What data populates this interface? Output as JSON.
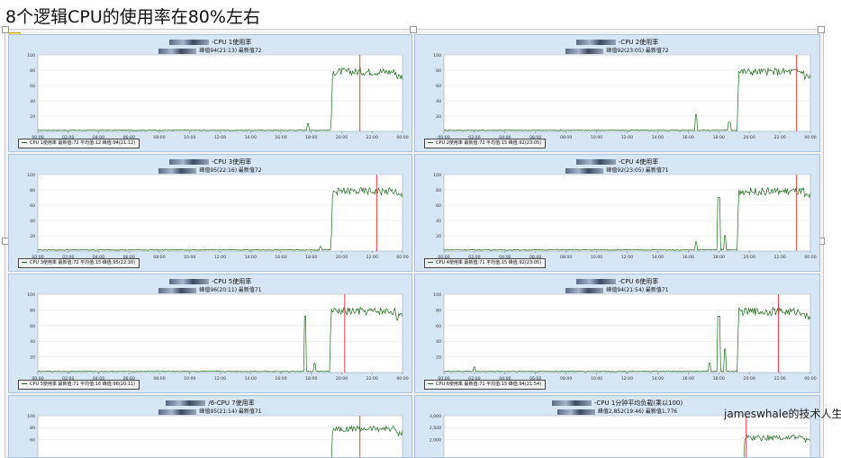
{
  "page_title": "8个逻辑CPU的使用率在80%左右",
  "watermark": "jameswhale的技术人生",
  "colors": {
    "series": "#1a6b1a",
    "marker": "#e0262c",
    "panel_bg": "#d6e6f5",
    "plot_bg": "#ffffff",
    "grid": "#e2e2e2"
  },
  "icons": {
    "favorite": "star-icon"
  },
  "chart_data": [
    {
      "type": "line",
      "title": "-CPU 1使用率",
      "subtitle": "峰值94(21:13) 最新值72",
      "yticks": [
        "100",
        "80",
        "60",
        "40",
        "20"
      ],
      "ylim": [
        0,
        100
      ],
      "xticks": [
        "00:00",
        "02:00",
        "04:00",
        "06:00",
        "08:00",
        "10:00",
        "12:00",
        "14:00",
        "16:00",
        "18:00",
        "20:00",
        "22:00",
        "00:00"
      ],
      "legend": "CPU 1使用率 最新值:72 平均值:12 峰值:94(21:12)",
      "series": [
        {
          "name": "CPU 1使用率",
          "baseline": 1,
          "spikes": [
            [
              17.8,
              10
            ]
          ],
          "rise_at": 19.3,
          "plateau": 78,
          "end_value": 72
        }
      ],
      "marker_hour": 21.2
    },
    {
      "type": "line",
      "title": "-CPU 2使用率",
      "subtitle": "峰值92(23:05) 最新值72",
      "yticks": [
        "100",
        "80",
        "60",
        "40",
        "20"
      ],
      "ylim": [
        0,
        100
      ],
      "xticks": [
        "00:00",
        "02:00",
        "04:00",
        "06:00",
        "08:00",
        "10:00",
        "12:00",
        "14:00",
        "16:00",
        "18:00",
        "20:00",
        "22:00",
        "00:00"
      ],
      "legend": "CPU 2使用率 最新值:72 平均值:15 峰值:92(23:05)",
      "series": [
        {
          "name": "CPU 2使用率",
          "baseline": 1,
          "spikes": [
            [
              16.5,
              22
            ],
            [
              18.7,
              12
            ]
          ],
          "rise_at": 19.2,
          "plateau": 78,
          "end_value": 72
        }
      ],
      "marker_hour": 23.1
    },
    {
      "type": "line",
      "title": "-CPU 3使用率",
      "subtitle": "峰值95(22:16) 最新值72",
      "yticks": [
        "100",
        "80",
        "60",
        "40",
        "20"
      ],
      "ylim": [
        0,
        100
      ],
      "xticks": [
        "00:00",
        "02:00",
        "04:00",
        "06:00",
        "08:00",
        "10:00",
        "12:00",
        "14:00",
        "16:00",
        "18:00",
        "20:00",
        "22:00",
        "00:00"
      ],
      "legend": "CPU 3使用率 最新值:72 平均值:15 峰值:95(22:16)",
      "series": [
        {
          "name": "CPU 3使用率",
          "baseline": 1,
          "spikes": [
            [
              18.6,
              6
            ]
          ],
          "rise_at": 19.3,
          "plateau": 78,
          "end_value": 72
        }
      ],
      "marker_hour": 22.3
    },
    {
      "type": "line",
      "title": "-CPU 4使用率",
      "subtitle": "峰值92(23:05) 最新值71",
      "yticks": [
        "100",
        "80",
        "60",
        "40",
        "20"
      ],
      "ylim": [
        0,
        100
      ],
      "xticks": [
        "00:00",
        "02:00",
        "04:00",
        "06:00",
        "08:00",
        "10:00",
        "12:00",
        "14:00",
        "16:00",
        "18:00",
        "20:00",
        "22:00",
        "00:00"
      ],
      "legend": "CPU 4使用率 最新值:71 平均值:15 峰值:92(23:05)",
      "series": [
        {
          "name": "CPU 4使用率",
          "baseline": 1,
          "spikes": [
            [
              16.5,
              12
            ],
            [
              18.0,
              70
            ],
            [
              18.4,
              20
            ]
          ],
          "rise_at": 19.2,
          "plateau": 78,
          "end_value": 71
        }
      ],
      "marker_hour": 23.1
    },
    {
      "type": "line",
      "title": "-CPU 5使用率",
      "subtitle": "峰值96(20:11) 最新值71",
      "yticks": [
        "100",
        "80",
        "60",
        "40",
        "20"
      ],
      "ylim": [
        0,
        100
      ],
      "xticks": [
        "00:00",
        "02:00",
        "04:00",
        "06:00",
        "08:00",
        "10:00",
        "12:00",
        "14:00",
        "16:00",
        "18:00",
        "20:00",
        "22:00",
        "00:00"
      ],
      "legend": "CPU 5使用率 最新值:71 平均值:16 峰值:96(20:11)",
      "series": [
        {
          "name": "CPU 5使用率",
          "baseline": 1,
          "spikes": [
            [
              17.6,
              72
            ],
            [
              18.2,
              12
            ]
          ],
          "rise_at": 19.2,
          "plateau": 78,
          "end_value": 71
        }
      ],
      "marker_hour": 20.2
    },
    {
      "type": "line",
      "title": "-CPU 6使用率",
      "subtitle": "峰值94(21:54) 最新值71",
      "yticks": [
        "100",
        "80",
        "60",
        "40",
        "20"
      ],
      "ylim": [
        0,
        100
      ],
      "xticks": [
        "00:00",
        "02:00",
        "04:00",
        "06:00",
        "08:00",
        "10:00",
        "12:00",
        "14:00",
        "16:00",
        "18:00",
        "20:00",
        "22:00",
        "00:00"
      ],
      "legend": "CPU 6使用率 最新值:71 平均值:15 峰值:94(21:54)",
      "series": [
        {
          "name": "CPU 6使用率",
          "baseline": 1,
          "spikes": [
            [
              2.0,
              7
            ],
            [
              17.4,
              12
            ],
            [
              18.0,
              72
            ],
            [
              18.4,
              30
            ]
          ],
          "rise_at": 19.2,
          "plateau": 78,
          "end_value": 71
        }
      ],
      "marker_hour": 21.9
    },
    {
      "type": "line",
      "title": "/6-CPU 7使用率",
      "subtitle": "峰值95(21:14) 最新值71",
      "yticks": [
        "100",
        "80",
        "60"
      ],
      "ylim": [
        0,
        100
      ],
      "xticks": [],
      "legend": "",
      "series": [
        {
          "name": "CPU 7使用率",
          "baseline": 1,
          "spikes": [],
          "rise_at": 19.3,
          "plateau": 78,
          "end_value": 71
        }
      ],
      "marker_hour": 21.2
    },
    {
      "type": "line",
      "title": "-CPU 1分钟平均负载(乘以100)",
      "subtitle": "峰值2,852(19:46) 最新值1,776",
      "yticks": [
        "3,000",
        "2,500",
        "2,000"
      ],
      "ylim": [
        0,
        3000
      ],
      "xticks": [],
      "legend": "",
      "series": [
        {
          "name": "CPU 1分钟平均负载(乘以100)",
          "baseline": 20,
          "spikes": [],
          "rise_at": 19.6,
          "plateau": 1900,
          "end_value": 1776
        }
      ],
      "marker_hour": 19.8
    }
  ]
}
